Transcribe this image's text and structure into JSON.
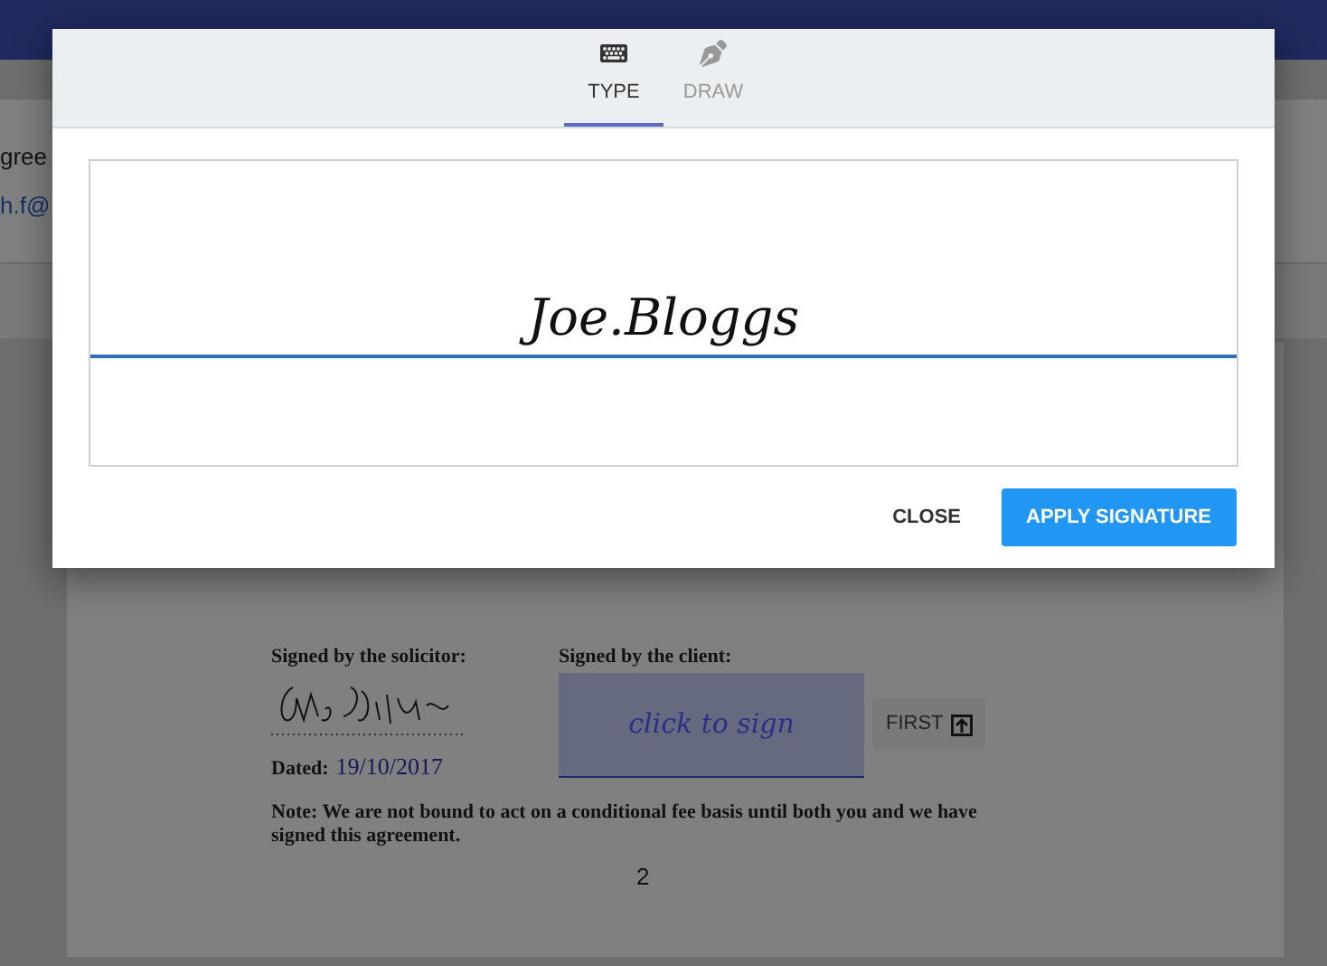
{
  "background": {
    "header_lines": [
      "gree",
      "h.f@"
    ],
    "document": {
      "solicitor_label": "Signed by the solicitor:",
      "client_label": "Signed by the client:",
      "sign_prompt": "click to sign",
      "first_button": "FIRST",
      "dated_label": "Dated:",
      "dated_value": "19/10/2017",
      "note": "Note: We are not bound to act on a conditional fee basis until both you and we have signed this agreement.",
      "page_number": "2"
    }
  },
  "dialog": {
    "tabs": [
      {
        "label": "TYPE",
        "selected": true
      },
      {
        "label": "DRAW",
        "selected": false
      }
    ],
    "typed_signature": "Joe.Bloggs",
    "buttons": [
      {
        "label": "CLOSE",
        "kind": "text"
      },
      {
        "label": "APPLY SIGNATURE",
        "kind": "primary"
      }
    ]
  }
}
